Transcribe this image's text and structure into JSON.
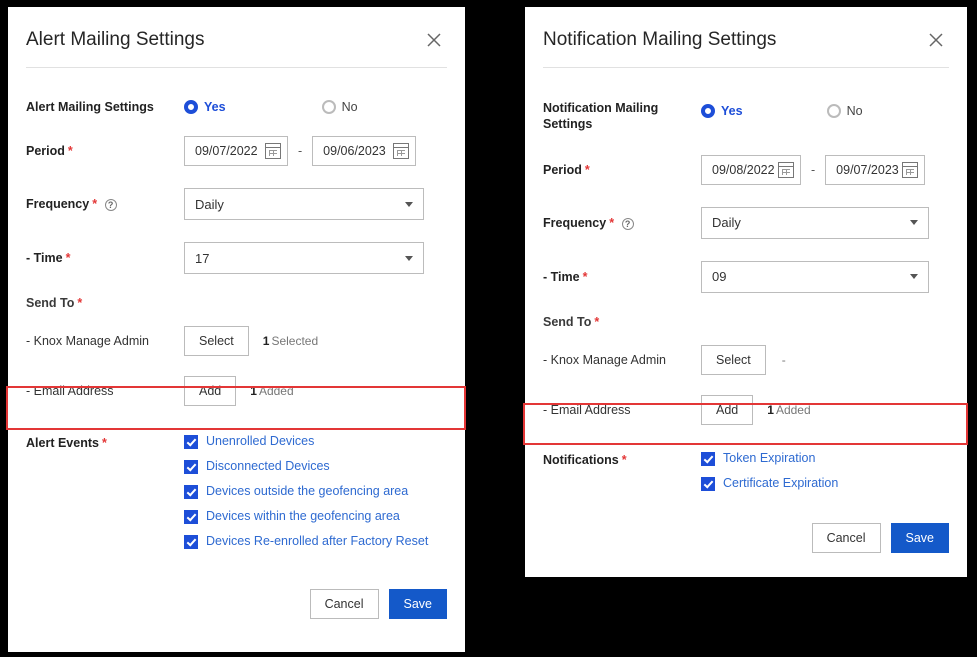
{
  "shared": {
    "yes": "Yes",
    "no": "No",
    "cancel": "Cancel",
    "save": "Save"
  },
  "left": {
    "title": "Alert Mailing Settings",
    "fields": {
      "enable": {
        "label": "Alert Mailing Settings",
        "value": "Yes"
      },
      "period": {
        "label": "Period",
        "start": "09/07/2022",
        "end": "09/06/2023"
      },
      "frequency": {
        "label": "Frequency",
        "value": "Daily"
      },
      "time": {
        "label": "- Time",
        "value": "17"
      },
      "sendto": {
        "label": "Send To",
        "knox": {
          "label": "- Knox Manage Admin",
          "button": "Select",
          "count": "1",
          "count_word": "Selected"
        },
        "email": {
          "label": "- Email Address",
          "button": "Add",
          "count": "1",
          "count_word": "Added"
        }
      }
    },
    "events": {
      "label": "Alert Events",
      "items": [
        "Unenrolled Devices",
        "Disconnected Devices",
        "Devices outside the geofencing area",
        "Devices within the geofencing area",
        "Devices Re-enrolled after Factory Reset"
      ]
    }
  },
  "right": {
    "title": "Notification Mailing Settings",
    "fields": {
      "enable": {
        "label": "Notification Mailing Settings",
        "value": "Yes"
      },
      "period": {
        "label": "Period",
        "start": "09/08/2022",
        "end": "09/07/2023"
      },
      "frequency": {
        "label": "Frequency",
        "value": "Daily"
      },
      "time": {
        "label": "- Time",
        "value": "09"
      },
      "sendto": {
        "label": "Send To",
        "knox": {
          "label": "- Knox Manage Admin",
          "button": "Select",
          "count": "",
          "count_word": "-"
        },
        "email": {
          "label": "- Email Address",
          "button": "Add",
          "count": "1",
          "count_word": "Added"
        }
      }
    },
    "events": {
      "label": "Notifications",
      "items": [
        "Token Expiration",
        "Certificate Expiration"
      ]
    }
  }
}
